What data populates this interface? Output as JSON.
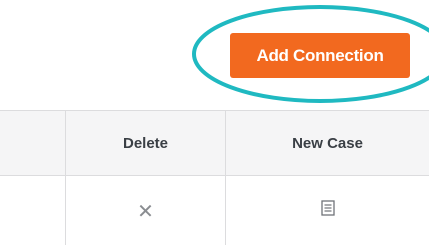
{
  "toolbar": {
    "add_connection_label": "Add Connection",
    "accent_color": "#f2691f",
    "highlight_color": "#1fb9c1"
  },
  "table": {
    "columns": [
      "",
      "Delete",
      "New Case"
    ],
    "rows": [
      {
        "delete_icon": "close-icon",
        "new_case_icon": "document-icon"
      }
    ]
  }
}
